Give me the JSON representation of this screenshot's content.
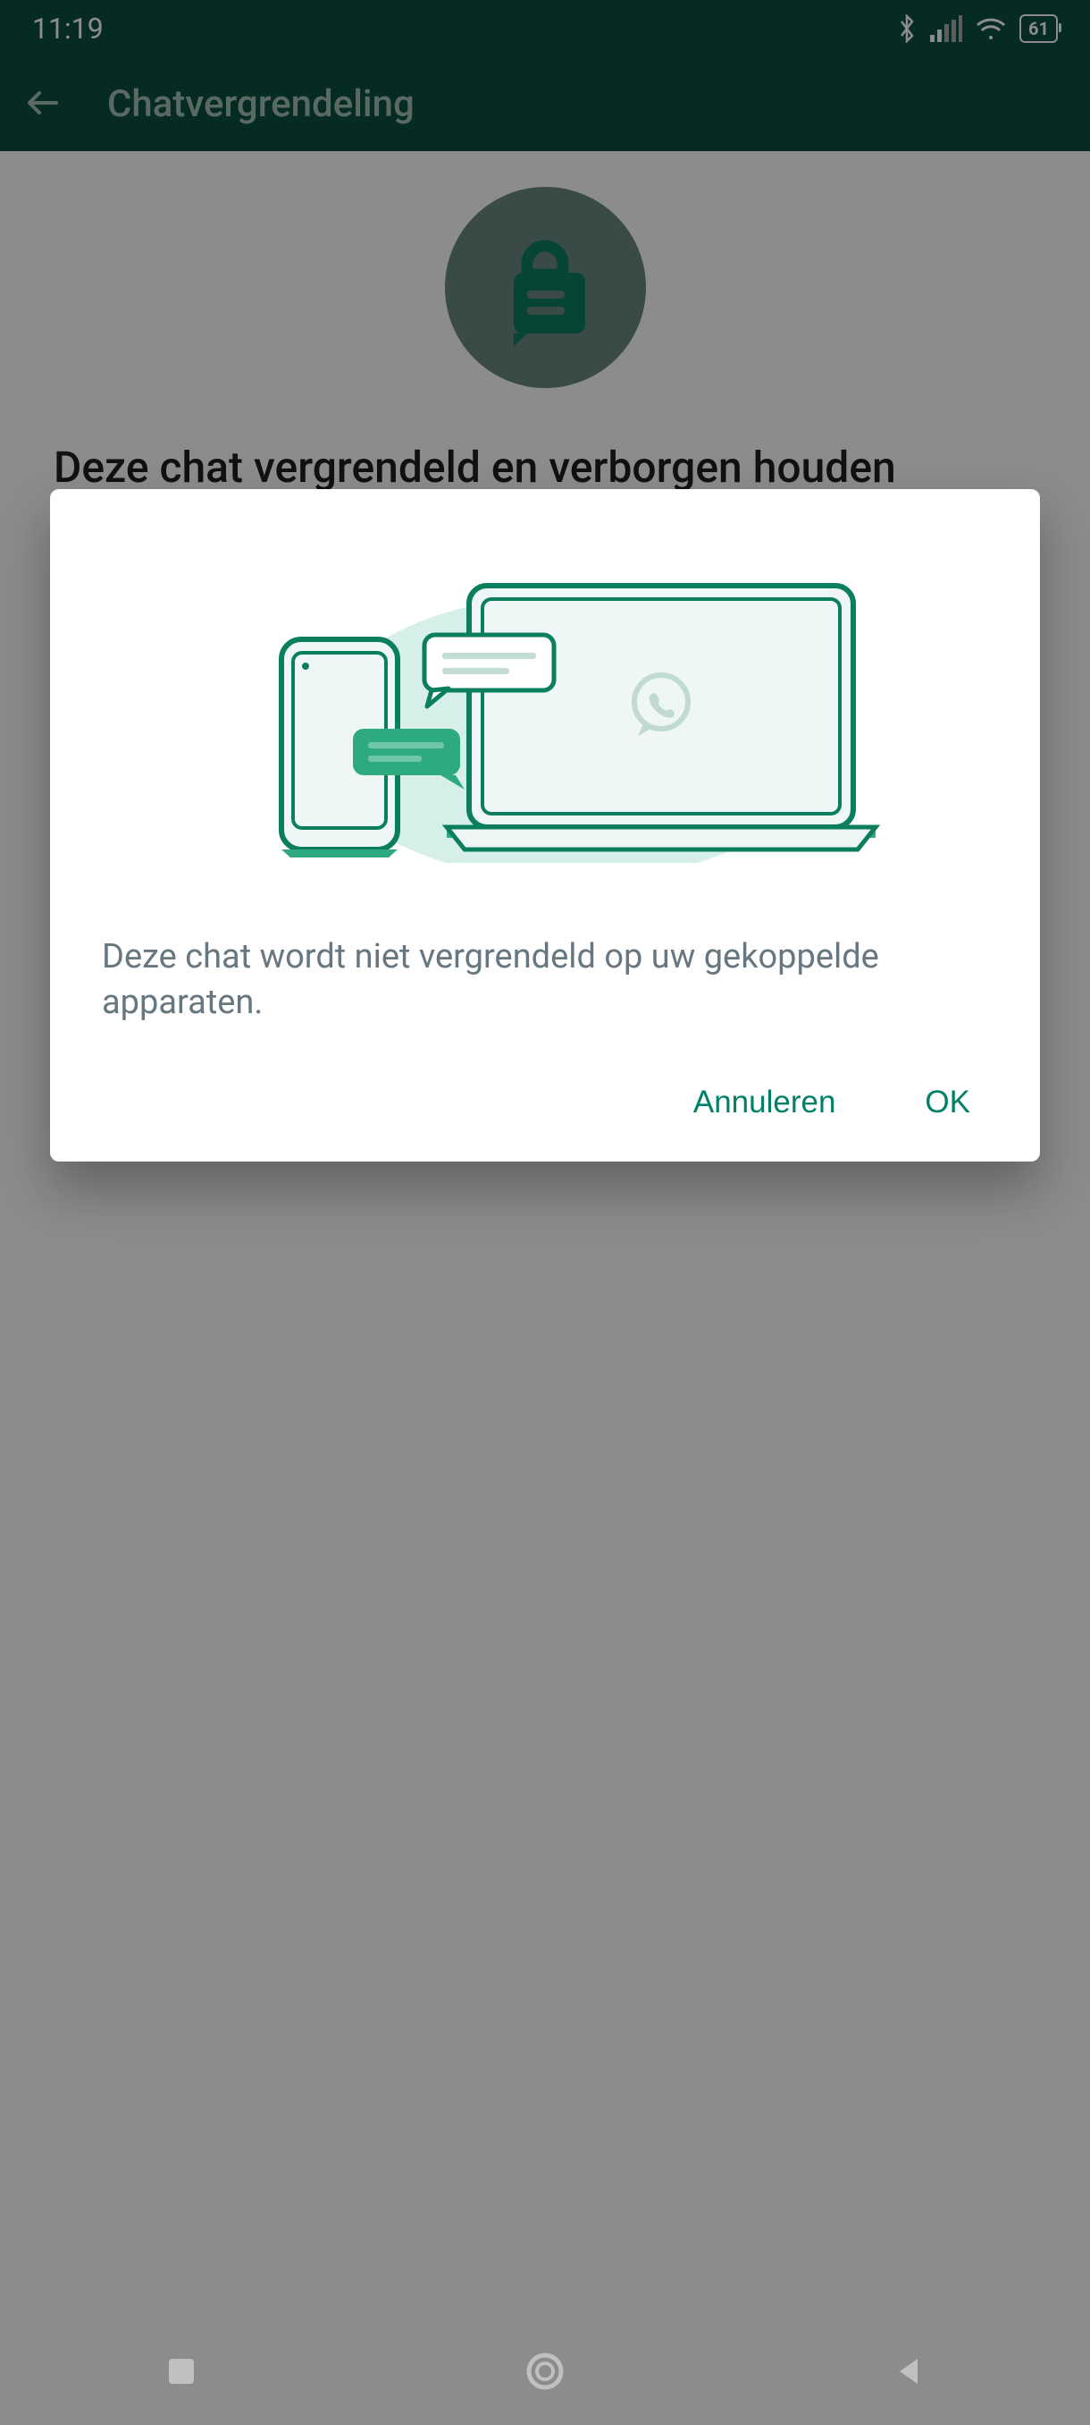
{
  "status_bar": {
    "time": "11:19",
    "battery": "61"
  },
  "header": {
    "title": "Chatvergrendeling"
  },
  "page": {
    "heading": "Deze chat vergrendeld en verborgen houden"
  },
  "dialog": {
    "message": "Deze chat wordt niet vergrendeld op uw gekoppelde apparaten.",
    "cancel_label": "Annuleren",
    "ok_label": "OK"
  }
}
